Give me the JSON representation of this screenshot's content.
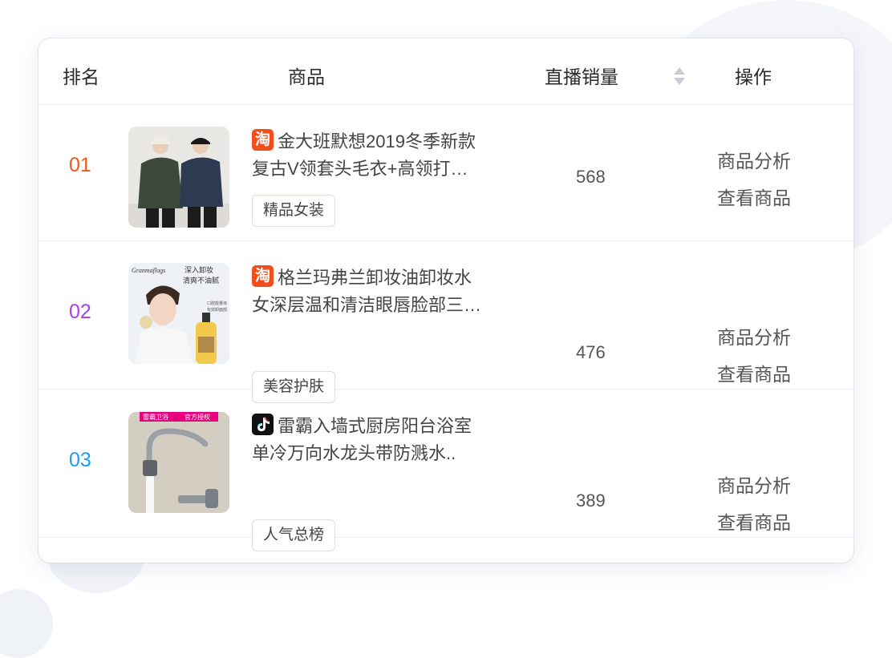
{
  "header": {
    "rank": "排名",
    "product": "商品",
    "sales": "直播销量",
    "action": "操作"
  },
  "rows": [
    {
      "rank": "01",
      "rank_color": "#f2561d",
      "platform": "taobao",
      "platform_glyph": "淘",
      "title_line1": "金大班默想2019冬季新款",
      "title_line2": "复古V领套头毛衣+高领打…",
      "tag": "精品女装",
      "sales": "568",
      "action_analyze": "商品分析",
      "action_view": "查看商品"
    },
    {
      "rank": "02",
      "rank_color": "#a93ff0",
      "platform": "taobao",
      "platform_glyph": "淘",
      "title_line1": "格兰玛弗兰卸妆油卸妆水",
      "title_line2": "女深层温和清洁眼唇脸部三…",
      "tag": "美容护肤",
      "sales": "476",
      "action_analyze": "商品分析",
      "action_view": "查看商品",
      "thumb_text": {
        "brand": "Granmaflags",
        "line1": "深入卸妆",
        "line2": "清爽不油腻",
        "badge1": "口腔能量液",
        "badge2": "有效卸面部"
      }
    },
    {
      "rank": "03",
      "rank_color": "#1a9cf5",
      "platform": "douyin",
      "platform_glyph": "",
      "title_line1": "雷霸入墙式厨房阳台浴室",
      "title_line2": "单冷万向水龙头带防溅水..",
      "tag": "人气总榜",
      "sales": "389",
      "action_analyze": "商品分析",
      "action_view": "查看商品",
      "thumb_text": {
        "banner1": "雷霸卫浴",
        "banner2": "官方授权"
      }
    }
  ],
  "colors": {
    "taobao": "#f24e1b",
    "douyin": "#111111",
    "border": "#eceef3"
  },
  "icons": [
    "sort-icon",
    "taobao-icon",
    "douyin-icon"
  ]
}
